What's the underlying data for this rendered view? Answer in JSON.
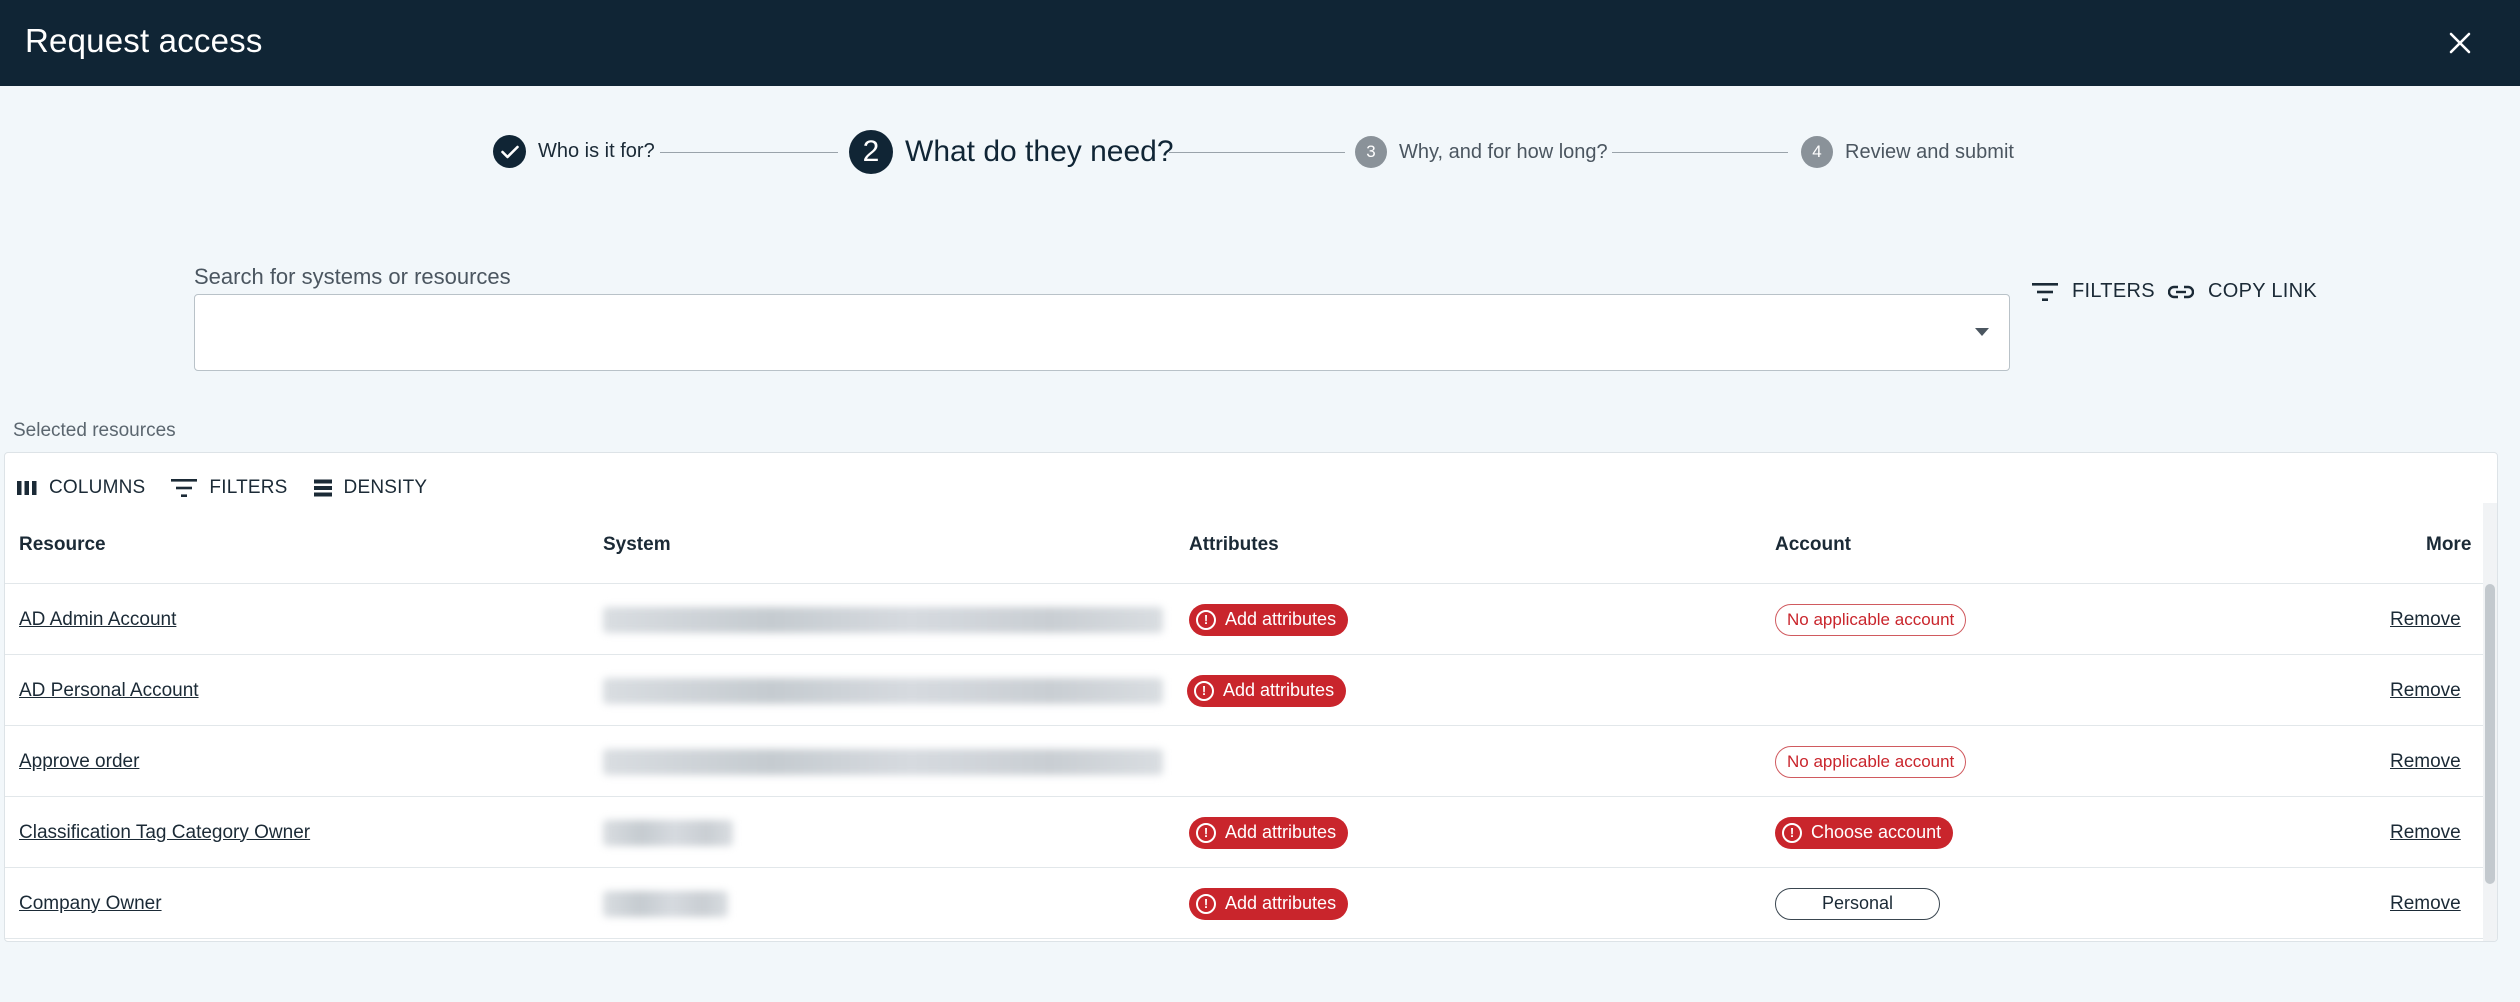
{
  "header": {
    "title": "Request access",
    "close_icon": "close-icon"
  },
  "stepper": {
    "steps": [
      {
        "number": "1",
        "label": "Who is it for?",
        "state": "completed"
      },
      {
        "number": "2",
        "label": "What do they need?",
        "state": "active"
      },
      {
        "number": "3",
        "label": "Why, and for how long?",
        "state": "upcoming"
      },
      {
        "number": "4",
        "label": "Review and submit",
        "state": "upcoming"
      }
    ]
  },
  "search": {
    "label": "Search for systems or resources",
    "value": "",
    "placeholder": ""
  },
  "actions": {
    "filters": "FILTERS",
    "copy_link": "COPY LINK"
  },
  "selected": {
    "label": "Selected resources",
    "toolbar": {
      "columns": "COLUMNS",
      "filters": "FILTERS",
      "density": "DENSITY"
    },
    "columns": [
      "Resource",
      "System",
      "Attributes",
      "Account",
      "More"
    ],
    "rows": [
      {
        "resource": "AD Admin Account",
        "attributes": "Add attributes",
        "account": "No applicable account",
        "account_kind": "none",
        "remove": "Remove"
      },
      {
        "resource": "AD Personal Account",
        "attributes": "Add attributes",
        "account": "",
        "account_kind": "",
        "remove": "Remove"
      },
      {
        "resource": "Approve order",
        "attributes": "",
        "account": "No applicable account",
        "account_kind": "none",
        "remove": "Remove"
      },
      {
        "resource": "Classification Tag Category Owner",
        "attributes": "Add attributes",
        "account": "Choose account",
        "account_kind": "choose",
        "remove": "Remove"
      },
      {
        "resource": "Company Owner",
        "attributes": "Add attributes",
        "account": "Personal",
        "account_kind": "selected",
        "remove": "Remove"
      }
    ]
  },
  "colors": {
    "header_bg": "#102535",
    "page_bg": "#f2f7fa",
    "error_red": "#c9252c",
    "step_inactive": "#8a9299"
  }
}
